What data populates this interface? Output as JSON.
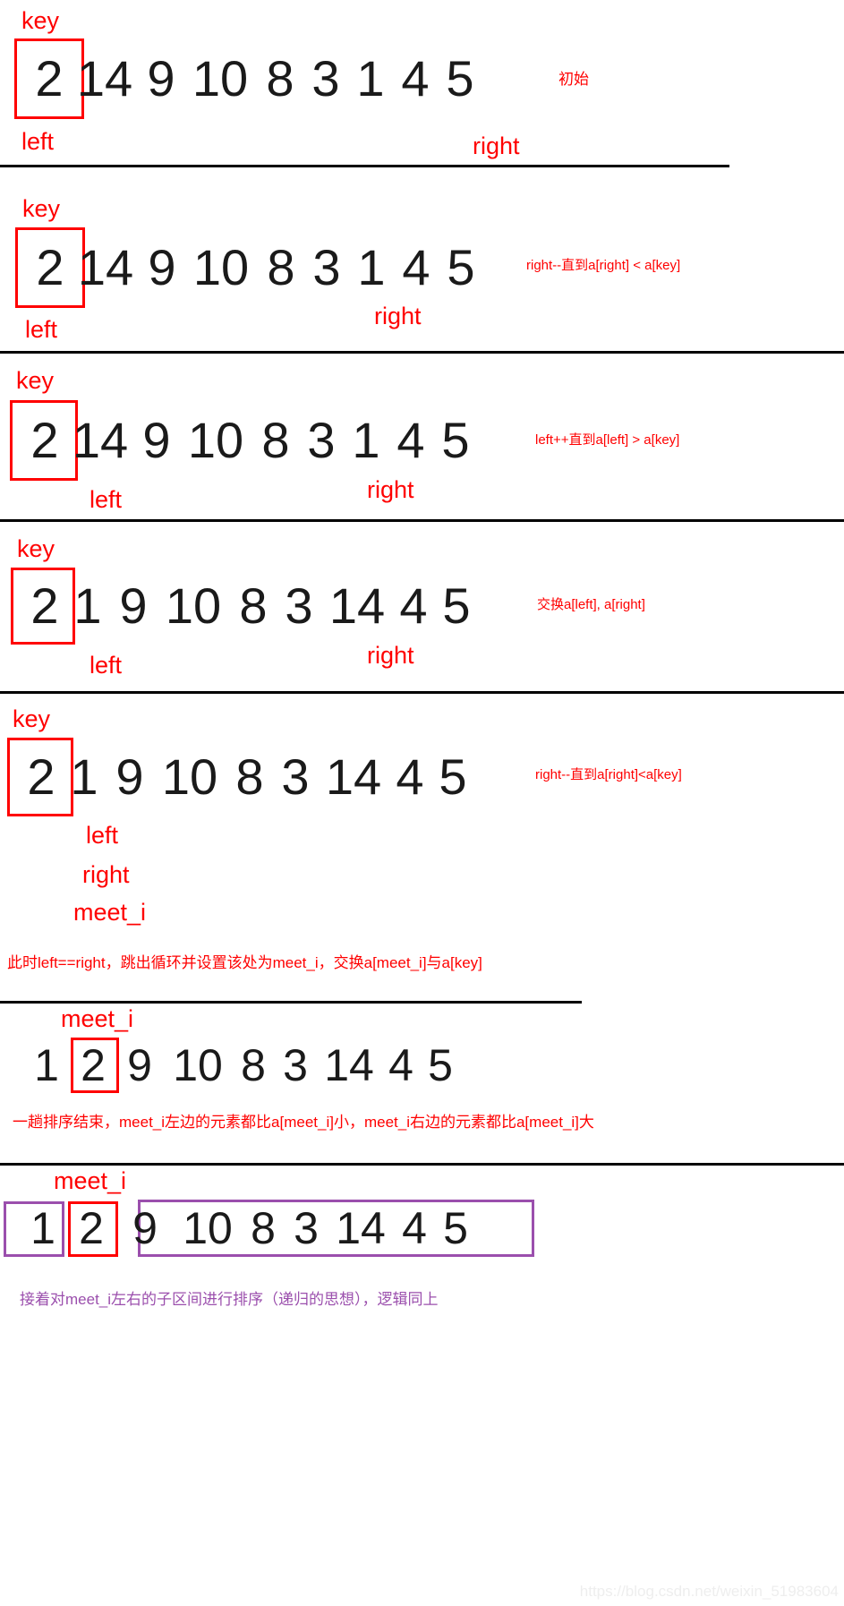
{
  "watermark": "https://blog.csdn.net/weixin_51983604",
  "colors": {
    "annotation_red": "#ff0000",
    "annotation_purple": "#9b4fad",
    "number_black": "#1a1a1a",
    "divider_black": "#000000",
    "background": "#ffffff"
  },
  "steps": [
    {
      "id": "step-1-initial",
      "numbers": [
        "2",
        "14",
        "9",
        "10",
        "8",
        "3",
        "1",
        "4",
        "5"
      ],
      "key_label": "key",
      "left_label": "left",
      "right_label": "right",
      "note": "初始"
    },
    {
      "id": "step-2-right-scan",
      "numbers": [
        "2",
        "14",
        "9",
        "10",
        "8",
        "3",
        "1",
        "4",
        "5"
      ],
      "key_label": "key",
      "left_label": "left",
      "right_label": "right",
      "note": "right--直到a[right] < a[key]"
    },
    {
      "id": "step-3-left-scan",
      "numbers": [
        "2",
        "14",
        "9",
        "10",
        "8",
        "3",
        "1",
        "4",
        "5"
      ],
      "key_label": "key",
      "left_label": "left",
      "right_label": "right",
      "note": "left++直到a[left] > a[key]"
    },
    {
      "id": "step-4-swap",
      "numbers": [
        "2",
        "1",
        "9",
        "10",
        "8",
        "3",
        "14",
        "4",
        "5"
      ],
      "key_label": "key",
      "left_label": "left",
      "right_label": "right",
      "note": "交换a[left], a[right]"
    },
    {
      "id": "step-5-meet",
      "numbers": [
        "2",
        "1",
        "9",
        "10",
        "8",
        "3",
        "14",
        "4",
        "5"
      ],
      "key_label": "key",
      "left_label": "left",
      "right_label": "right",
      "meet_label": "meet_i",
      "note": "right--直到a[right]<a[key]",
      "caption": "此时left==right，跳出循环并设置该处为meet_i，交换a[meet_i]与a[key]"
    },
    {
      "id": "step-6-partitioned",
      "numbers": [
        "1",
        "2",
        "9",
        "10",
        "8",
        "3",
        "14",
        "4",
        "5"
      ],
      "meet_label": "meet_i",
      "caption": "一趟排序结束，meet_i左边的元素都比a[meet_i]小，meet_i右边的元素都比a[meet_i]大"
    },
    {
      "id": "step-7-recurse",
      "numbers": [
        "1",
        "2",
        "9",
        "10",
        "8",
        "3",
        "14",
        "4",
        "5"
      ],
      "meet_label": "meet_i",
      "caption": "接着对meet_i左右的子区间进行排序（递归的思想），逻辑同上"
    }
  ]
}
